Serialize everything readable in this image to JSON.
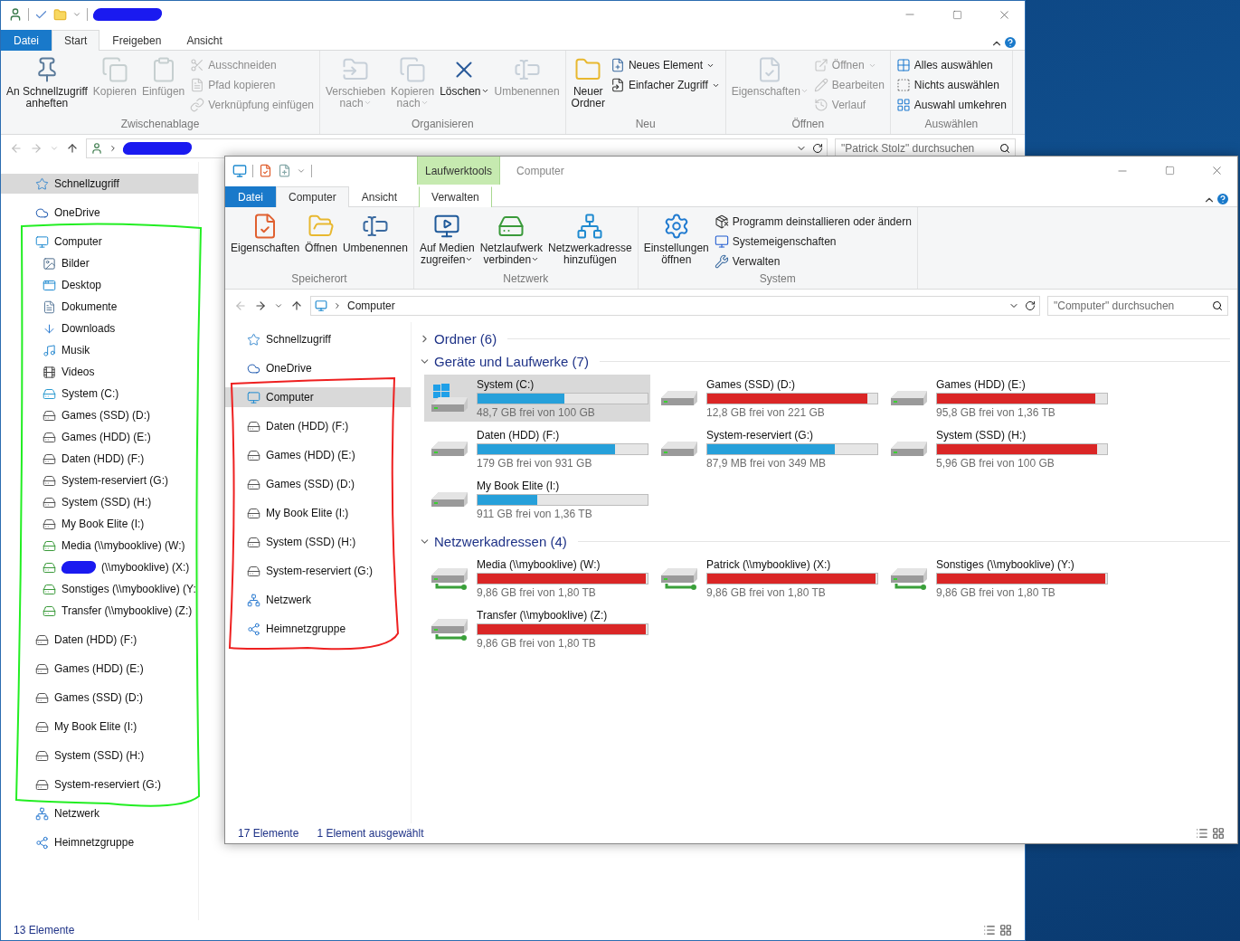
{
  "back_window": {
    "tabs": [
      {
        "label": "Datei",
        "kind": "file",
        "selected": false
      },
      {
        "label": "Start",
        "kind": "normal",
        "selected": true
      },
      {
        "label": "Freigeben",
        "kind": "normal",
        "selected": false
      },
      {
        "label": "Ansicht",
        "kind": "normal",
        "selected": false
      }
    ],
    "ribbon": [
      {
        "label": "Zwischenablage",
        "items": [
          {
            "label": "An Schnellzugriff\nanheften",
            "kind": "large",
            "disabled": false,
            "dropdown": false
          },
          {
            "label": "Kopieren",
            "kind": "large",
            "disabled": true,
            "dropdown": false
          },
          {
            "label": "Einfügen",
            "kind": "large",
            "disabled": true,
            "dropdown": false
          },
          {
            "label": "Ausschneiden",
            "kind": "small",
            "disabled": true,
            "dropdown": false
          },
          {
            "label": "Pfad kopieren",
            "kind": "small",
            "disabled": true,
            "dropdown": false
          },
          {
            "label": "Verknüpfung einfügen",
            "kind": "small",
            "disabled": true,
            "dropdown": false
          }
        ]
      },
      {
        "label": "Organisieren",
        "items": [
          {
            "label": "Verschieben\nnach",
            "kind": "large",
            "disabled": true,
            "dropdown": true
          },
          {
            "label": "Kopieren\nnach",
            "kind": "large",
            "disabled": true,
            "dropdown": true
          },
          {
            "label": "Löschen",
            "kind": "large",
            "disabled": false,
            "dropdown": true
          },
          {
            "label": "Umbenennen",
            "kind": "large",
            "disabled": true,
            "dropdown": false
          }
        ]
      },
      {
        "label": "Neu",
        "items": [
          {
            "label": "Neuer\nOrdner",
            "kind": "large",
            "disabled": false,
            "dropdown": false
          },
          {
            "label": "Neues Element",
            "kind": "small",
            "disabled": false,
            "dropdown": true
          },
          {
            "label": "Einfacher Zugriff",
            "kind": "small",
            "disabled": false,
            "dropdown": true
          }
        ]
      },
      {
        "label": "Öffnen",
        "items": [
          {
            "label": "Eigenschaften",
            "kind": "large",
            "disabled": true,
            "dropdown": true
          },
          {
            "label": "Öffnen",
            "kind": "small",
            "disabled": true,
            "dropdown": true
          },
          {
            "label": "Bearbeiten",
            "kind": "small",
            "disabled": true,
            "dropdown": false
          },
          {
            "label": "Verlauf",
            "kind": "small",
            "disabled": true,
            "dropdown": false
          }
        ]
      },
      {
        "label": "Auswählen",
        "items": [
          {
            "label": "Alles auswählen",
            "kind": "small",
            "disabled": false,
            "dropdown": false
          },
          {
            "label": "Nichts auswählen",
            "kind": "small",
            "disabled": false,
            "dropdown": false
          },
          {
            "label": "Auswahl umkehren",
            "kind": "small",
            "disabled": false,
            "dropdown": false
          }
        ]
      }
    ],
    "search": {
      "placeholder": "\"Patrick Stolz\" durchsuchen"
    },
    "nav": [
      {
        "label": "Schnellzugriff",
        "kind": "star",
        "selected": true
      },
      {
        "label": "OneDrive",
        "kind": "cloud",
        "selected": false
      },
      {
        "label": "Computer",
        "kind": "computer",
        "selected": false,
        "children": [
          {
            "label": "Bilder",
            "kind": "pictures",
            "selected": false
          },
          {
            "label": "Desktop",
            "kind": "desktop",
            "selected": false
          },
          {
            "label": "Dokumente",
            "kind": "documents",
            "selected": false
          },
          {
            "label": "Downloads",
            "kind": "downloads",
            "selected": false
          },
          {
            "label": "Musik",
            "kind": "music",
            "selected": false
          },
          {
            "label": "Videos",
            "kind": "videos",
            "selected": false
          },
          {
            "label": "System (C:)",
            "kind": "windrive",
            "selected": false
          },
          {
            "label": "Games (SSD) (D:)",
            "kind": "drive",
            "selected": false
          },
          {
            "label": "Games (HDD) (E:)",
            "kind": "drive",
            "selected": false
          },
          {
            "label": "Daten (HDD) (F:)",
            "kind": "drive",
            "selected": false
          },
          {
            "label": "System-reserviert (G:)",
            "kind": "drive",
            "selected": false
          },
          {
            "label": "System (SSD) (H:)",
            "kind": "drive",
            "selected": false
          },
          {
            "label": "My Book Elite (I:)",
            "kind": "drive",
            "selected": false
          },
          {
            "label": "Media (\\\\mybooklive) (W:)",
            "kind": "netdrive",
            "selected": false
          },
          {
            "label": "(\\\\mybooklive) (X:)",
            "kind": "netdrive",
            "selected": false,
            "redacted": true
          },
          {
            "label": "Sonstiges (\\\\mybooklive) (Y:",
            "kind": "netdrive",
            "selected": false
          },
          {
            "label": "Transfer (\\\\mybooklive) (Z:)",
            "kind": "netdrive",
            "selected": false
          }
        ]
      },
      {
        "label": "Daten (HDD) (F:)",
        "kind": "drive",
        "selected": false
      },
      {
        "label": "Games (HDD) (E:)",
        "kind": "drive",
        "selected": false
      },
      {
        "label": "Games (SSD) (D:)",
        "kind": "drive",
        "selected": false
      },
      {
        "label": "My Book Elite (I:)",
        "kind": "drive",
        "selected": false
      },
      {
        "label": "System (SSD) (H:)",
        "kind": "drive",
        "selected": false
      },
      {
        "label": "System-reserviert (G:)",
        "kind": "drive",
        "selected": false
      },
      {
        "label": "Netzwerk",
        "kind": "network",
        "selected": false
      },
      {
        "label": "Heimnetzgruppe",
        "kind": "homegroup",
        "selected": false
      }
    ],
    "status_bar": [
      "13 Elemente"
    ]
  },
  "front_window": {
    "title": "Computer",
    "contextual_group": "Laufwerktools",
    "tabs": [
      {
        "label": "Datei",
        "kind": "file",
        "selected": false
      },
      {
        "label": "Computer",
        "kind": "normal",
        "selected": true
      },
      {
        "label": "Ansicht",
        "kind": "normal",
        "selected": false
      },
      {
        "label": "Verwalten",
        "kind": "contextual",
        "selected": false
      }
    ],
    "ribbon": [
      {
        "label": "Speicherort",
        "items": [
          {
            "label": "Eigenschaften",
            "kind": "large",
            "disabled": false,
            "dropdown": false
          },
          {
            "label": "Öffnen",
            "kind": "large",
            "disabled": false,
            "dropdown": false
          },
          {
            "label": "Umbenennen",
            "kind": "large",
            "disabled": false,
            "dropdown": false
          }
        ]
      },
      {
        "label": "Netzwerk",
        "items": [
          {
            "label": "Auf Medien\nzugreifen",
            "kind": "large",
            "disabled": false,
            "dropdown": true
          },
          {
            "label": "Netzlaufwerk\nverbinden",
            "kind": "large",
            "disabled": false,
            "dropdown": true
          },
          {
            "label": "Netzwerkadresse\nhinzufügen",
            "kind": "large",
            "disabled": false,
            "dropdown": false
          }
        ]
      },
      {
        "label": "System",
        "items": [
          {
            "label": "Einstellungen\nöffnen",
            "kind": "large",
            "disabled": false,
            "dropdown": false
          },
          {
            "label": "Programm deinstallieren oder ändern",
            "kind": "small",
            "disabled": false,
            "dropdown": false
          },
          {
            "label": "Systemeigenschaften",
            "kind": "small",
            "disabled": false,
            "dropdown": false
          },
          {
            "label": "Verwalten",
            "kind": "small",
            "disabled": false,
            "dropdown": false
          }
        ]
      }
    ],
    "address": {
      "path": "Computer"
    },
    "search": {
      "placeholder": "\"Computer\" durchsuchen"
    },
    "nav": [
      {
        "label": "Schnellzugriff",
        "kind": "star",
        "selected": false
      },
      {
        "label": "OneDrive",
        "kind": "cloud",
        "selected": false
      },
      {
        "label": "Computer",
        "kind": "computer",
        "selected": true
      },
      {
        "label": "Daten (HDD) (F:)",
        "kind": "drive",
        "selected": false
      },
      {
        "label": "Games (HDD) (E:)",
        "kind": "drive",
        "selected": false
      },
      {
        "label": "Games (SSD) (D:)",
        "kind": "drive",
        "selected": false
      },
      {
        "label": "My Book Elite (I:)",
        "kind": "drive",
        "selected": false
      },
      {
        "label": "System (SSD) (H:)",
        "kind": "drive",
        "selected": false
      },
      {
        "label": "System-reserviert (G:)",
        "kind": "drive",
        "selected": false
      },
      {
        "label": "Netzwerk",
        "kind": "network",
        "selected": false
      },
      {
        "label": "Heimnetzgruppe",
        "kind": "homegroup",
        "selected": false
      }
    ],
    "sections": [
      {
        "title": "Ordner (6)",
        "expanded": false
      },
      {
        "title": "Geräte und Laufwerke (7)",
        "expanded": true,
        "items": [
          {
            "name": "System (C:)",
            "free": "48,7 GB frei von 100 GB",
            "level": 0.51,
            "color": "#26a0da",
            "kind": "windows",
            "selected": true
          },
          {
            "name": "Games (SSD) (D:)",
            "free": "12,8 GB frei von 221 GB",
            "level": 0.94,
            "color": "#da2626",
            "kind": "local",
            "selected": false
          },
          {
            "name": "Games (HDD) (E:)",
            "free": "95,8 GB frei von 1,36 TB",
            "level": 0.93,
            "color": "#da2626",
            "kind": "local",
            "selected": false
          },
          {
            "name": "Daten (HDD) (F:)",
            "free": "179 GB frei von 931 GB",
            "level": 0.81,
            "color": "#26a0da",
            "kind": "local",
            "selected": false
          },
          {
            "name": "System-reserviert (G:)",
            "free": "87,9 MB frei von 349 MB",
            "level": 0.75,
            "color": "#26a0da",
            "kind": "local",
            "selected": false
          },
          {
            "name": "System (SSD) (H:)",
            "free": "5,96 GB frei von 100 GB",
            "level": 0.94,
            "color": "#da2626",
            "kind": "local",
            "selected": false
          },
          {
            "name": "My Book Elite (I:)",
            "free": "911 GB frei von 1,36 TB",
            "level": 0.35,
            "color": "#26a0da",
            "kind": "local",
            "selected": false
          }
        ]
      },
      {
        "title": "Netzwerkadressen (4)",
        "expanded": true,
        "items": [
          {
            "name": "Media (\\\\mybooklive) (W:)",
            "free": "9,86 GB frei von 1,80 TB",
            "level": 0.99,
            "color": "#da2626",
            "kind": "network",
            "selected": false
          },
          {
            "name": "Patrick (\\\\mybooklive) (X:)",
            "free": "9,86 GB frei von 1,80 TB",
            "level": 0.99,
            "color": "#da2626",
            "kind": "network",
            "selected": false
          },
          {
            "name": "Sonstiges (\\\\mybooklive) (Y:)",
            "free": "9,86 GB frei von 1,80 TB",
            "level": 0.99,
            "color": "#da2626",
            "kind": "network",
            "selected": false
          },
          {
            "name": "Transfer (\\\\mybooklive) (Z:)",
            "free": "9,86 GB frei von 1,80 TB",
            "level": 0.99,
            "color": "#da2626",
            "kind": "network",
            "selected": false
          }
        ]
      }
    ],
    "status_bar": [
      "17 Elemente",
      "1 Element ausgewählt"
    ]
  }
}
